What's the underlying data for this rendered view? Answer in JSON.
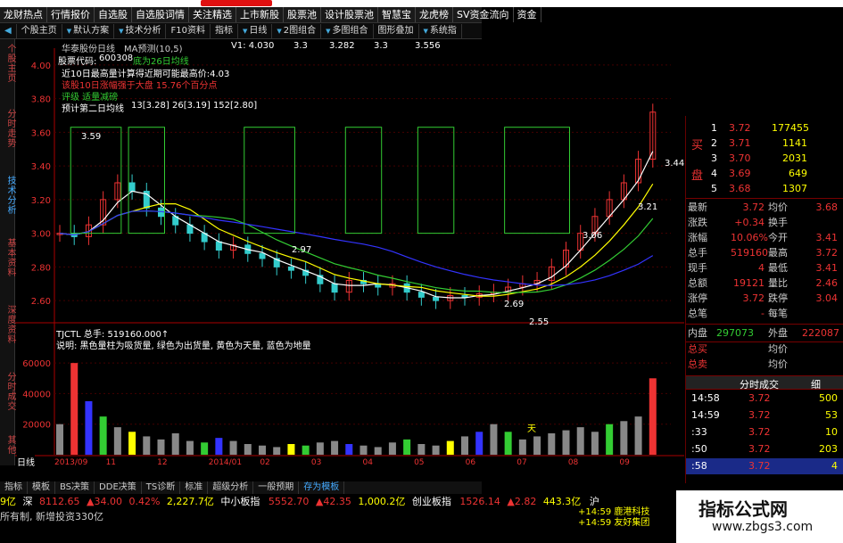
{
  "topnav": [
    "龙财热点",
    "行情报价",
    "自选股",
    "自选股词情",
    "关注精选",
    "上市新股",
    "股票池",
    "设计股票池",
    "智慧宝",
    "龙虎榜",
    "SV资金流向",
    "资金"
  ],
  "toolbar": {
    "home": "个股主页",
    "items": [
      "默认方案",
      "技术分析",
      "F10资料",
      "指标",
      "日线",
      "2图组合",
      "多图组合",
      "图形叠加",
      "系统指"
    ]
  },
  "left_tabs": [
    "个股主页",
    "分时走势",
    "技术分析",
    "基本资料",
    "深度资料",
    "分时成交",
    "其他"
  ],
  "header": {
    "stock_title": "华泰股份日线",
    "ma_label": "MA预测(10,5)",
    "v1_label": "V1: 4.030",
    "ma_values": [
      "3.3",
      "3.282",
      "3.3",
      "3.556"
    ]
  },
  "info": {
    "code_label": "股票代码:",
    "code": "600308",
    "code_note": "底为26日均线",
    "line2": "近10日最高量计算得近期可能最高价:4.03",
    "line3": "该股10日涨幅强于大盘 15.76个百分点",
    "line4": "评级 适量减磅",
    "line5_label": "预计第二日均线",
    "line5_values": "13[3.28]  26[3.19]  152[2.80]"
  },
  "price_annotations": {
    "a1": "3.59",
    "a2": "2.97",
    "a3": "3.06",
    "a4": "3.21",
    "a5": "3.44",
    "a6": "2.55",
    "a7": "2.69"
  },
  "volume": {
    "title": "TJCTL 总手: 519160.000↑",
    "desc": "说明: 黑色量柱为吸货量, 绿色为出货量, 黄色为天量, 蓝色为地量",
    "marker": "天"
  },
  "chart_data": [
    {
      "type": "line",
      "title": "华泰股份日线",
      "ylim": [
        2.5,
        4.1
      ],
      "yticks": [
        "4.00",
        "3.80",
        "3.60",
        "3.40",
        "3.20",
        "3.00",
        "2.80",
        "2.60"
      ],
      "xlabel": "",
      "ylabel": "",
      "x_ticks": [
        "2013/09",
        "11",
        "12",
        "2014/01",
        "02",
        "03",
        "04",
        "05",
        "06",
        "07",
        "08",
        "09"
      ],
      "series": [],
      "close": [
        3.0,
        2.98,
        3.05,
        3.2,
        3.3,
        3.25,
        3.15,
        3.1,
        3.05,
        3.0,
        2.95,
        2.9,
        2.93,
        2.88,
        2.85,
        2.8,
        2.78,
        2.75,
        2.7,
        2.65,
        2.72,
        2.7,
        2.68,
        2.7,
        2.65,
        2.62,
        2.6,
        2.63,
        2.62,
        2.64,
        2.65,
        2.68,
        2.7,
        2.72,
        2.8,
        2.9,
        3.0,
        3.1,
        3.2,
        3.3,
        3.44,
        3.72
      ]
    },
    {
      "type": "bar",
      "title": "TJCTL",
      "ylim": [
        0,
        70000
      ],
      "yticks": [
        "60000",
        "40000",
        "20000"
      ],
      "values": [
        20000,
        60000,
        35000,
        25000,
        18000,
        15000,
        12000,
        10000,
        14000,
        9000,
        8000,
        11000,
        9000,
        7000,
        6000,
        5000,
        7000,
        6000,
        8000,
        9000,
        7000,
        6000,
        5000,
        8000,
        10000,
        7000,
        6000,
        9000,
        12000,
        15000,
        20000,
        15000,
        10000,
        12000,
        14000,
        16000,
        18000,
        15000,
        20000,
        22000,
        25000,
        50000
      ]
    }
  ],
  "quote": {
    "buy_label": "买",
    "pan_label": "盘",
    "bids": [
      {
        "n": "1",
        "price": "3.72",
        "vol": "177455"
      },
      {
        "n": "2",
        "price": "3.71",
        "vol": "1141"
      },
      {
        "n": "3",
        "price": "3.70",
        "vol": "2031"
      },
      {
        "n": "4",
        "price": "3.69",
        "vol": "649"
      },
      {
        "n": "5",
        "price": "3.68",
        "vol": "1307"
      }
    ],
    "stats": [
      {
        "l1": "最新",
        "v1": "3.72",
        "l2": "均价",
        "v2": "3.68"
      },
      {
        "l1": "涨跌",
        "v1": "+0.34",
        "l2": "换手",
        "v2": ""
      },
      {
        "l1": "涨幅",
        "v1": "10.06%",
        "l2": "今开",
        "v2": "3.41"
      },
      {
        "l1": "总手",
        "v1": "519160",
        "l2": "最高",
        "v2": "3.72"
      },
      {
        "l1": "现手",
        "v1": "4",
        "l2": "最低",
        "v2": "3.41"
      },
      {
        "l1": "总额",
        "v1": "19121",
        "l2": "量比",
        "v2": "2.46"
      },
      {
        "l1": "涨停",
        "v1": "3.72",
        "l2": "跌停",
        "v2": "3.04"
      },
      {
        "l1": "总笔",
        "v1": "-",
        "l2": "每笔",
        "v2": ""
      }
    ],
    "inner_label": "内盘",
    "inner": "297073",
    "outer_label": "外盘",
    "outer": "222087",
    "zongmai_label": "总买",
    "zongmai_sub": "均价",
    "zongmai2_label": "总卖",
    "zongmai2_sub": "均价",
    "trades_title": "分时成交",
    "trades_arrow": "细",
    "trades": [
      {
        "t": "14:58",
        "p": "3.72",
        "v": "500"
      },
      {
        "t": "14:59",
        "p": "3.72",
        "v": "53"
      },
      {
        "t": ":33",
        "p": "3.72",
        "v": "10"
      },
      {
        "t": ":50",
        "p": "3.72",
        "v": "203"
      },
      {
        "t": ":58",
        "p": "3.72",
        "v": "4"
      }
    ]
  },
  "bottom_tabs": [
    "指标",
    "模板",
    "BS决策",
    "DDE决策",
    "TS诊断",
    "标准",
    "超级分析",
    "一般预期",
    "存为模板"
  ],
  "bottom_active": "存为模板",
  "period_label": "日线",
  "ticker": {
    "part1": "9亿",
    "part2": "深",
    "sz_index": "8112.65",
    "sz_chg": "▲34.00",
    "sz_pct": "0.42%",
    "sz_amt": "2,227.7亿",
    "zxb_label": "中小板指",
    "zxb_index": "5552.70",
    "zxb_chg": "▲42.35",
    "zxb_amt": "1,000.2亿",
    "cyb_label": "创业板指",
    "cyb_index": "1526.14",
    "cyb_chg": "▲2.82",
    "cyb_amt": "443.3亿",
    "hu": "沪"
  },
  "status": {
    "text": "所有制, 新增投资330亿",
    "alert1": "+14:59 鹿港科技",
    "alert2": "+14:59 友好集团"
  },
  "watermark": {
    "title": "指标公式网",
    "url": "www.zbgs3.com"
  }
}
